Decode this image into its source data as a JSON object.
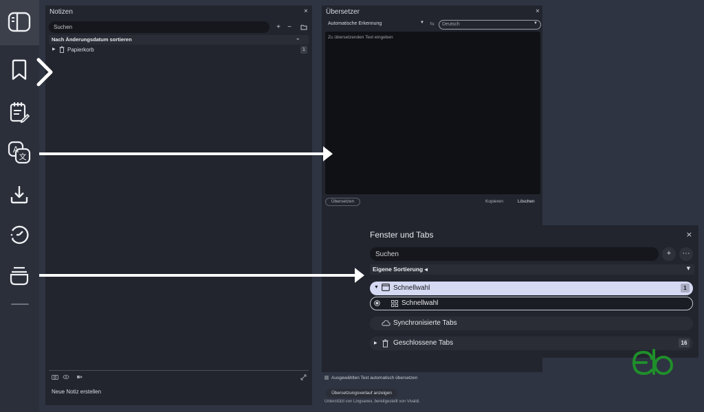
{
  "notes": {
    "title": "Notizen",
    "close": "×",
    "search_placeholder": "Suchen",
    "add": "+",
    "remove": "−",
    "sort_label": "Nach Änderungsdatum sortieren",
    "trash_label": "Papierkorb",
    "trash_count": "1",
    "new_note": "Neue Notiz erstellen"
  },
  "translator": {
    "title": "Übersetzer",
    "close": "×",
    "source_language": "Automatische Erkennung",
    "target_language": "Deutsch",
    "input_placeholder": "Zu übersetzenden Text eingeben",
    "translate_button": "Übersetzen",
    "copy_button": "Kopieren",
    "clear_button": "Löschen",
    "auto_translate_label": "Ausgewählten Text automatisch übersetzen",
    "history_button": "Übersetzungsverlauf anzeigen",
    "powered_by": "Unterstützt von Lingvanex, bereitgestellt von Vivaldi."
  },
  "windows": {
    "title": "Fenster und Tabs",
    "close": "×",
    "search_placeholder": "Suchen",
    "add": "+",
    "more": "···",
    "sort_label": "Eigene Sortierung ◂",
    "rows": [
      {
        "label": "Schnellwahl",
        "count": "1"
      },
      {
        "label": "Schnellwahl"
      },
      {
        "label": "Synchronisierte Tabs"
      },
      {
        "label": "Geschlossene Tabs",
        "count": "16"
      }
    ]
  },
  "rail": {
    "icons": [
      "panel-toggle-icon",
      "bookmarks-icon",
      "notes-icon",
      "translate-icon",
      "downloads-icon",
      "history-icon",
      "window-tabs-icon"
    ]
  },
  "colors": {
    "background": "#2e3442",
    "panel": "#22252e",
    "highlight": "#d6d9f2",
    "watermark": "#1f8f2a"
  }
}
